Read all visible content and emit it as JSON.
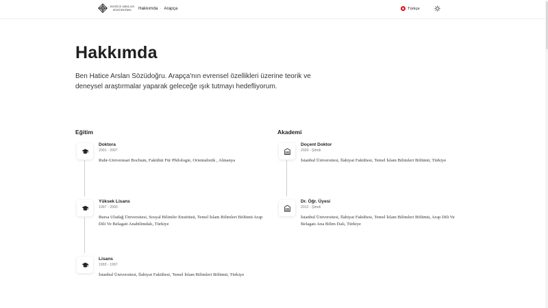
{
  "header": {
    "logo_line1": "HATİCE ARSLAN",
    "logo_line2": "SÖZÜDOĞRU",
    "nav": [
      "Hakkımda",
      "Arapça"
    ],
    "language": "Türkçe"
  },
  "hero": {
    "title": "Hakkımda",
    "intro": "Ben Hatice Arslan Sözüdoğru. Arapça'nın evrensel özellikleri üzerine teorik ve deneysel araştırmalar yaparak geleceğe ışık tutmayı hedefliyorum."
  },
  "education": {
    "title": "Eğitim",
    "items": [
      {
        "title": "Doktora",
        "date": "2001 - 2007",
        "desc": "Ruhr-Universtaet Bochum, Fakültät Für Philologie, Orientalistik , Almanya"
      },
      {
        "title": "Yüksek Lisans",
        "date": "1997 - 2000",
        "desc": "Bursa Uludağ Üniversitesi, Sosyal Bilimler Enstitüsü, Temel İslam Bilimleri Bölümü Arap Dili Ve Belagati Anabilimdalı, Türkiye"
      },
      {
        "title": "Lisans",
        "date": "1993 - 1997",
        "desc": "İstanbul Üniversitesi, İlahiyat Fakültesi, Temel İslam Bilimleri Bölümü, Türkiye"
      }
    ]
  },
  "academy": {
    "title": "Akademi",
    "items": [
      {
        "title": "Doçent Doktor",
        "date": "2020 - Şimdi",
        "desc": "İstanbul Üniversitesi, İlahiyat Fakültesi, Temel İslam Bilimleri Bölümü, Türkiye"
      },
      {
        "title": "Dr. Öğr. Üyesi",
        "date": "2012 - Şimdi",
        "desc": "İstanbul Üniversitesi, İlahiyat Fakültesi, Temel İslam Bilimleri Bölümü, Arap Dili Ve Belagatı Ana Bilim Dalı, Türkiye"
      }
    ]
  },
  "icons": {
    "education": "graduation-cap-icon",
    "academy": "university-building-icon",
    "theme": "sun-icon",
    "language": "turkey-flag-icon"
  }
}
